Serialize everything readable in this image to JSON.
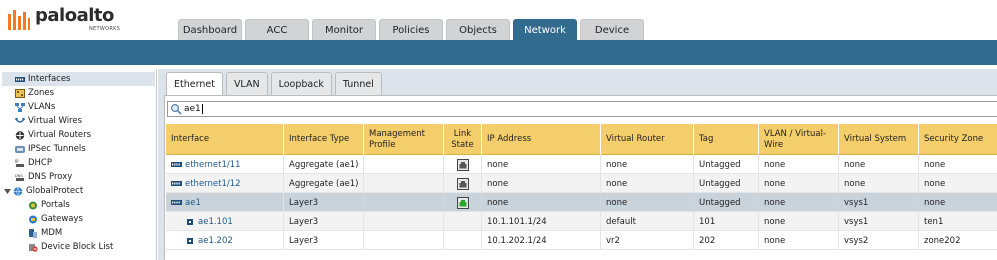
{
  "brand": {
    "name": "paloalto",
    "sub": "NETWORKS",
    "primary": "#336b8f",
    "header_accent": "#f4ce6a"
  },
  "main_tabs": [
    {
      "label": "Dashboard",
      "active": false
    },
    {
      "label": "ACC",
      "active": false
    },
    {
      "label": "Monitor",
      "active": false
    },
    {
      "label": "Policies",
      "active": false
    },
    {
      "label": "Objects",
      "active": false
    },
    {
      "label": "Network",
      "active": true
    },
    {
      "label": "Device",
      "active": false
    }
  ],
  "sidebar": {
    "items": [
      {
        "label": "Interfaces",
        "icon": "interfaces-icon",
        "selected": true
      },
      {
        "label": "Zones",
        "icon": "zones-icon"
      },
      {
        "label": "VLANs",
        "icon": "vlans-icon"
      },
      {
        "label": "Virtual Wires",
        "icon": "virtual-wires-icon"
      },
      {
        "label": "Virtual Routers",
        "icon": "virtual-routers-icon"
      },
      {
        "label": "IPSec Tunnels",
        "icon": "ipsec-tunnels-icon"
      },
      {
        "label": "DHCP",
        "icon": "dhcp-icon"
      },
      {
        "label": "DNS Proxy",
        "icon": "dns-proxy-icon"
      },
      {
        "label": "GlobalProtect",
        "icon": "globalprotect-icon"
      },
      {
        "label": "Portals",
        "icon": "portals-icon"
      },
      {
        "label": "Gateways",
        "icon": "gateways-icon"
      },
      {
        "label": "MDM",
        "icon": "mdm-icon"
      },
      {
        "label": "Device Block List",
        "icon": "device-block-list-icon"
      }
    ]
  },
  "sub_tabs": [
    {
      "label": "Ethernet",
      "active": true
    },
    {
      "label": "VLAN",
      "active": false
    },
    {
      "label": "Loopback",
      "active": false
    },
    {
      "label": "Tunnel",
      "active": false
    }
  ],
  "search": {
    "value": "ae1",
    "icon": "search-icon"
  },
  "table": {
    "headers": [
      "Interface",
      "Interface Type",
      "Management Profile",
      "Link State",
      "IP Address",
      "Virtual Router",
      "Tag",
      "VLAN / Virtual-Wire",
      "Virtual System",
      "Security Zone"
    ],
    "rows": [
      {
        "interface": "ethernet1/11",
        "type": "Aggregate (ae1)",
        "mgmt": "",
        "link": "down",
        "ip": "none",
        "vr": "none",
        "tag": "Untagged",
        "vlan": "none",
        "vsys": "none",
        "zone": "none"
      },
      {
        "interface": "ethernet1/12",
        "type": "Aggregate (ae1)",
        "mgmt": "",
        "link": "down",
        "ip": "none",
        "vr": "none",
        "tag": "Untagged",
        "vlan": "none",
        "vsys": "none",
        "zone": "none"
      },
      {
        "interface": "ae1",
        "type": "Layer3",
        "mgmt": "",
        "link": "up",
        "ip": "none",
        "vr": "none",
        "tag": "Untagged",
        "vlan": "none",
        "vsys": "vsys1",
        "zone": "none"
      },
      {
        "interface": "ae1.101",
        "type": "Layer3",
        "mgmt": "",
        "link": "",
        "ip": "10.1.101.1/24",
        "vr": "default",
        "tag": "101",
        "vlan": "none",
        "vsys": "vsys1",
        "zone": "ten1"
      },
      {
        "interface": "ae1.202",
        "type": "Layer3",
        "mgmt": "",
        "link": "",
        "ip": "10.1.202.1/24",
        "vr": "vr2",
        "tag": "202",
        "vlan": "none",
        "vsys": "vsys2",
        "zone": "zone202"
      }
    ]
  }
}
